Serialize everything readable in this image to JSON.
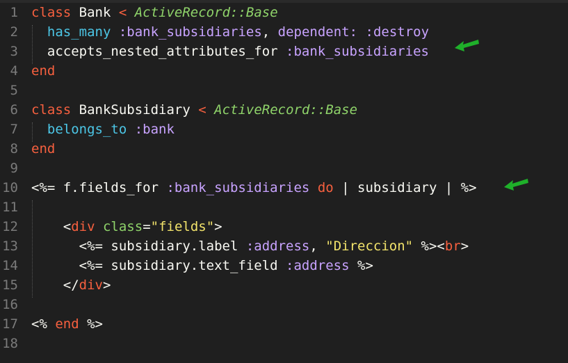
{
  "editor": {
    "line_numbers": [
      "1",
      "2",
      "3",
      "4",
      "5",
      "6",
      "7",
      "8",
      "9",
      "10",
      "11",
      "12",
      "13",
      "14",
      "15",
      "16",
      "17",
      "18"
    ],
    "lines": [
      [
        {
          "t": "class",
          "c": "#f7603f"
        },
        {
          "t": " Bank ",
          "c": "#f8f8f2"
        },
        {
          "t": "< ",
          "c": "#f7603f"
        },
        {
          "t": "ActiveRecord::Base",
          "c": "#8fd36a",
          "i": true
        }
      ],
      [
        {
          "t": "  ",
          "c": "#f8f8f2"
        },
        {
          "t": "has_many",
          "c": "#4cc6e6"
        },
        {
          "t": " ",
          "c": "#f8f8f2"
        },
        {
          "t": ":bank_subsidiaries",
          "c": "#c8a3ff"
        },
        {
          "t": ", ",
          "c": "#f8f8f2"
        },
        {
          "t": "dependent:",
          "c": "#c8a3ff"
        },
        {
          "t": " ",
          "c": "#f8f8f2"
        },
        {
          "t": ":destroy",
          "c": "#c8a3ff"
        }
      ],
      [
        {
          "t": "  accepts_nested_attributes_for ",
          "c": "#f8f8f2"
        },
        {
          "t": ":bank_subsidiaries",
          "c": "#c8a3ff"
        }
      ],
      [
        {
          "t": "end",
          "c": "#f7603f"
        }
      ],
      [],
      [
        {
          "t": "class",
          "c": "#f7603f"
        },
        {
          "t": " BankSubsidiary ",
          "c": "#f8f8f2"
        },
        {
          "t": "< ",
          "c": "#f7603f"
        },
        {
          "t": "ActiveRecord::Base",
          "c": "#8fd36a",
          "i": true
        }
      ],
      [
        {
          "t": "  ",
          "c": "#f8f8f2"
        },
        {
          "t": "belongs_to",
          "c": "#4cc6e6"
        },
        {
          "t": " ",
          "c": "#f8f8f2"
        },
        {
          "t": ":bank",
          "c": "#c8a3ff"
        }
      ],
      [
        {
          "t": "end",
          "c": "#f7603f"
        }
      ],
      [],
      [
        {
          "t": "<%= f.fields_for ",
          "c": "#f8f8f2"
        },
        {
          "t": ":bank_subsidiaries",
          "c": "#c8a3ff"
        },
        {
          "t": " ",
          "c": "#f8f8f2"
        },
        {
          "t": "do",
          "c": "#f7603f"
        },
        {
          "t": " | subsidiary | %>",
          "c": "#f8f8f2"
        }
      ],
      [],
      [
        {
          "t": "    <",
          "c": "#f8f8f2"
        },
        {
          "t": "div",
          "c": "#f7603f"
        },
        {
          "t": " ",
          "c": "#f8f8f2"
        },
        {
          "t": "class",
          "c": "#8fd36a"
        },
        {
          "t": "=",
          "c": "#f8f8f2"
        },
        {
          "t": "\"fields\"",
          "c": "#f2e36b"
        },
        {
          "t": ">",
          "c": "#f8f8f2"
        }
      ],
      [
        {
          "t": "      <%= subsidiary.label ",
          "c": "#f8f8f2"
        },
        {
          "t": ":address",
          "c": "#c8a3ff"
        },
        {
          "t": ", ",
          "c": "#f8f8f2"
        },
        {
          "t": "\"Direccion\"",
          "c": "#f2e36b"
        },
        {
          "t": " %><",
          "c": "#f8f8f2"
        },
        {
          "t": "br",
          "c": "#f7603f"
        },
        {
          "t": ">",
          "c": "#f8f8f2"
        }
      ],
      [
        {
          "t": "      <%= subsidiary.text_field ",
          "c": "#f8f8f2"
        },
        {
          "t": ":address",
          "c": "#c8a3ff"
        },
        {
          "t": " %>",
          "c": "#f8f8f2"
        }
      ],
      [
        {
          "t": "    </",
          "c": "#f8f8f2"
        },
        {
          "t": "div",
          "c": "#f7603f"
        },
        {
          "t": ">",
          "c": "#f8f8f2"
        }
      ],
      [],
      [
        {
          "t": "<% ",
          "c": "#f8f8f2"
        },
        {
          "t": "end",
          "c": "#f7603f"
        },
        {
          "t": " %>",
          "c": "#f8f8f2"
        }
      ],
      []
    ]
  },
  "annotations": {
    "arrow_color": "#1fb02a",
    "arrow_icon": "green-arrow-pointing-left"
  }
}
